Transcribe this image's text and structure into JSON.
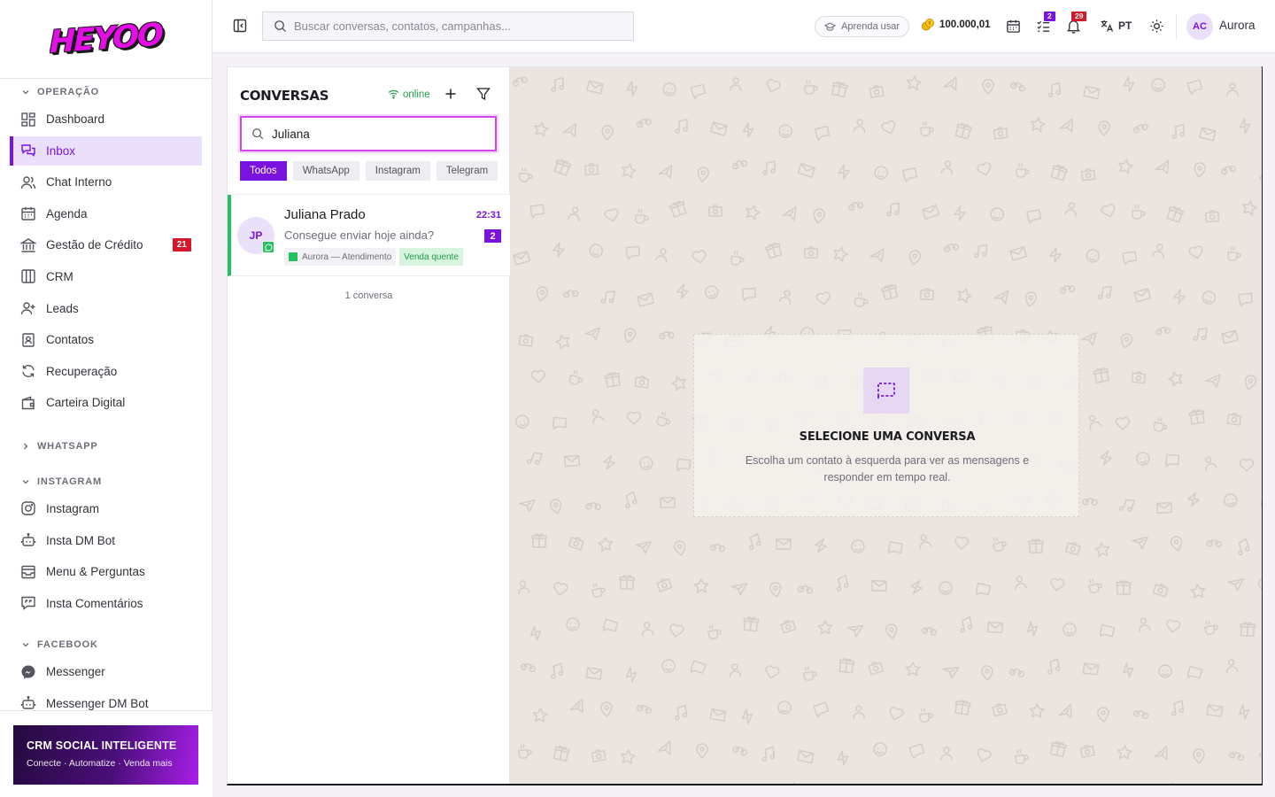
{
  "brand": {
    "logo_text": "HEYOO",
    "accent": "#7a12e0",
    "logo_color": "#e60ee6"
  },
  "sidebar": {
    "sections": {
      "operacao": "OPERAÇÃO",
      "whatsapp": "WHATSAPP",
      "instagram": "INSTAGRAM",
      "facebook": "FACEBOOK"
    },
    "operacao_items": [
      {
        "label": "Dashboard",
        "icon": "dashboard-icon"
      },
      {
        "label": "Inbox",
        "icon": "inbox-icon",
        "active": true
      },
      {
        "label": "Chat Interno",
        "icon": "users-icon"
      },
      {
        "label": "Agenda",
        "icon": "calendar-icon"
      },
      {
        "label": "Gestão de Crédito",
        "icon": "bank-icon",
        "badge": "21"
      },
      {
        "label": "CRM",
        "icon": "columns-icon"
      },
      {
        "label": "Leads",
        "icon": "user-plus-icon"
      },
      {
        "label": "Contatos",
        "icon": "contact-card-icon"
      },
      {
        "label": "Recuperação",
        "icon": "refresh-icon"
      },
      {
        "label": "Carteira Digital",
        "icon": "wallet-icon"
      }
    ],
    "instagram_items": [
      {
        "label": "Instagram",
        "icon": "instagram-icon"
      },
      {
        "label": "Insta DM Bot",
        "icon": "bot-icon"
      },
      {
        "label": "Menu & Perguntas",
        "icon": "inbox-tray-icon"
      },
      {
        "label": "Insta Comentários",
        "icon": "comment-quote-icon"
      }
    ],
    "facebook_items": [
      {
        "label": "Messenger",
        "icon": "messenger-icon"
      },
      {
        "label": "Messenger DM Bot",
        "icon": "bot-icon"
      }
    ],
    "promo": {
      "title": "CRM SOCIAL INTELIGENTE",
      "subtitle": "Conecte · Automatize · Venda mais"
    }
  },
  "topbar": {
    "search_placeholder": "Buscar conversas, contatos, campanhas...",
    "learn_label": "Aprenda usar",
    "coins": "100.000,01",
    "tasks_badge": "2",
    "notifications_badge": "29",
    "language": "PT",
    "user_initials": "AC",
    "user_name": "Aurora"
  },
  "conversations": {
    "title": "CONVERSAS",
    "status": "online",
    "search_value": "Juliana",
    "filters": [
      "Todos",
      "WhatsApp",
      "Instagram",
      "Telegram"
    ],
    "active_filter": "Todos",
    "items": [
      {
        "initials": "JP",
        "name": "Juliana Prado",
        "time": "22:31",
        "last_message": "Consegue enviar hoje ainda?",
        "unread": "2",
        "channel": "whatsapp",
        "agent_tag": "Aurora — Atendimento",
        "label_tag": "Venda quente"
      }
    ],
    "total_label": "1 conversa"
  },
  "chat_empty": {
    "title": "SELECIONE UMA CONVERSA",
    "text": "Escolha um contato à esquerda para ver as mensagens e responder em tempo real."
  }
}
